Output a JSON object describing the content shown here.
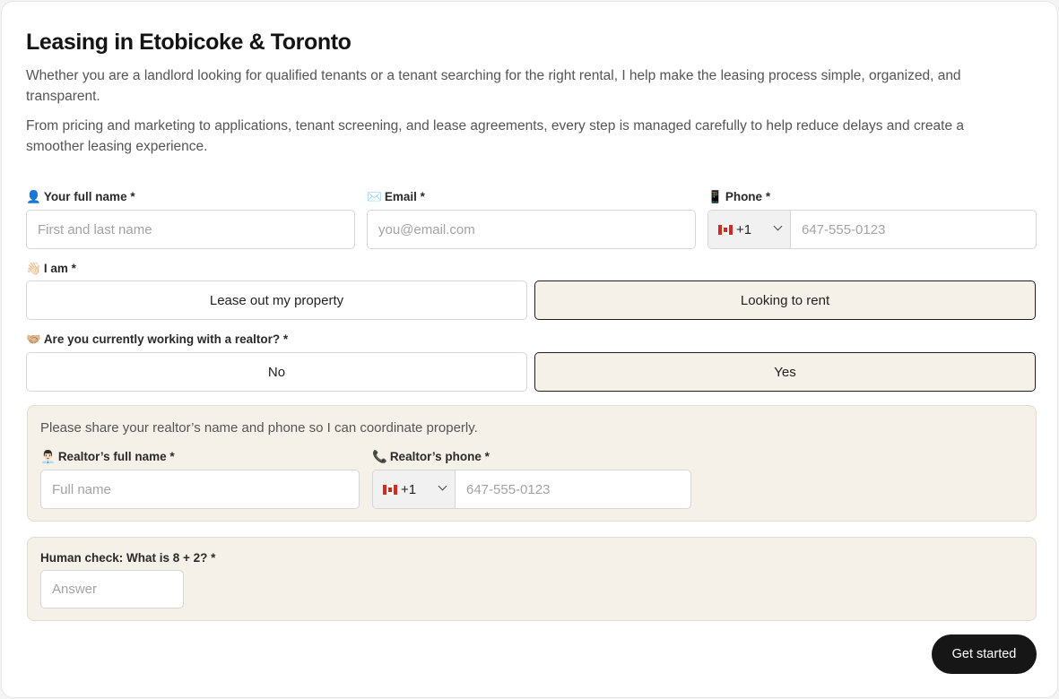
{
  "header": {
    "title": "Leasing in Etobicoke & Toronto",
    "paragraph1": "Whether you are a landlord looking for qualified tenants or a tenant searching for the right rental, I help make the leasing process simple, organized, and transparent.",
    "paragraph2": "From pricing and marketing to applications, tenant screening, and lease agreements, every step is managed carefully to help reduce delays and create a smoother leasing experience."
  },
  "form": {
    "full_name": {
      "icon": "👤",
      "label": "Your full name *",
      "placeholder": "First and last name",
      "value": ""
    },
    "email": {
      "icon": "✉️",
      "label": "Email *",
      "placeholder": "you@email.com",
      "value": ""
    },
    "phone": {
      "icon": "📱",
      "label": "Phone *",
      "country_code": "+1",
      "placeholder": "647-555-0123",
      "value": ""
    },
    "role": {
      "icon": "👋🏻",
      "label": "I am *",
      "options": [
        "Lease out my property",
        "Looking to rent"
      ],
      "selected": "Looking to rent"
    },
    "realtor_question": {
      "icon": "🤝🏼",
      "label": "Are you currently working with a realtor? *",
      "options": [
        "No",
        "Yes"
      ],
      "selected": "Yes"
    },
    "realtor_panel": {
      "note": "Please share your realtor’s name and phone so I can coordinate properly.",
      "name": {
        "icon": "👨🏻‍💼",
        "label": "Realtor’s full name *",
        "placeholder": "Full name",
        "value": ""
      },
      "phone": {
        "icon": "📞",
        "label": "Realtor’s phone *",
        "country_code": "+1",
        "placeholder": "647-555-0123",
        "value": ""
      }
    },
    "human_check": {
      "label": "Human check: What is 8 + 2? *",
      "placeholder": "Answer",
      "value": ""
    },
    "submit_label": "Get started"
  },
  "colors": {
    "selected_bg": "#f5f0e8",
    "button_bg": "#161616",
    "accent_flag": "#d52b1e"
  }
}
